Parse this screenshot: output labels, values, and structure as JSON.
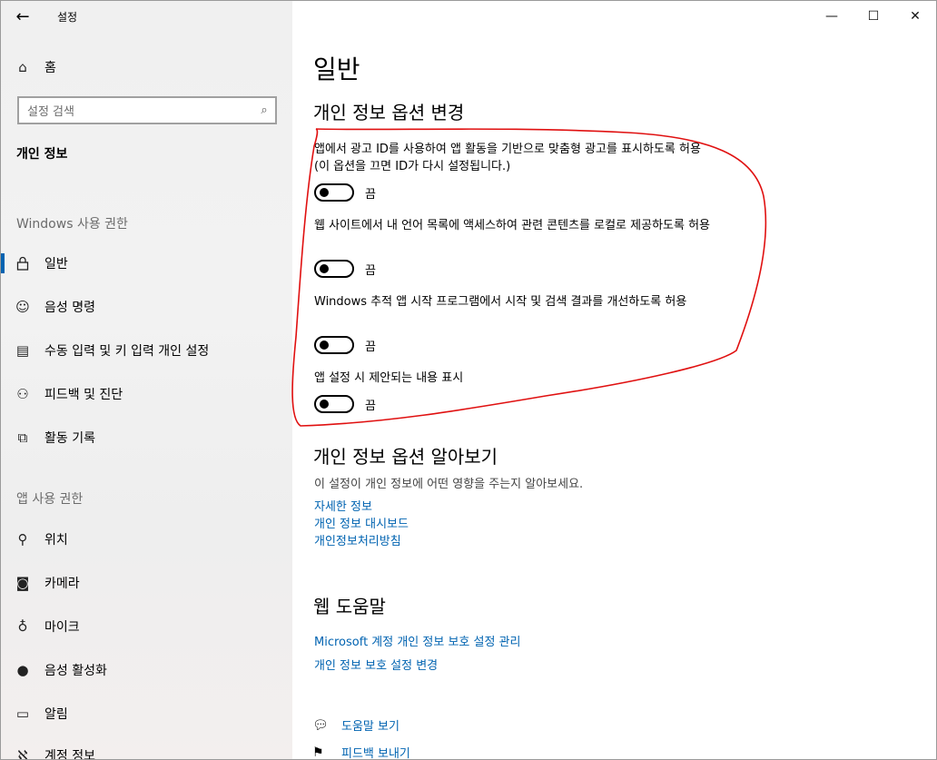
{
  "window": {
    "title": "설정",
    "back_icon": "←",
    "minimize_icon": "—",
    "maximize_icon": "☐",
    "close_icon": "✕"
  },
  "sidebar": {
    "home_label": "홈",
    "home_icon": "⌂",
    "search_placeholder": "설정 검색",
    "search_icon": "⌕",
    "category_title": "개인 정보",
    "section1_label": "Windows 사용 권한",
    "section2_label": "앱 사용 권한",
    "items": [
      {
        "label": "일반",
        "icon": "🔒︎",
        "selected": true
      },
      {
        "label": "음성 명령",
        "icon": "☺"
      },
      {
        "label": "수동 입력 및 키 입력 개인 설정",
        "icon": "▤"
      },
      {
        "label": "피드백 및 진단",
        "icon": "⚇"
      },
      {
        "label": "활동 기록",
        "icon": "⧉"
      },
      {
        "label": "위치",
        "icon": "⚲"
      },
      {
        "label": "카메라",
        "icon": "◙"
      },
      {
        "label": "마이크",
        "icon": "♁"
      },
      {
        "label": "음성 활성화",
        "icon": "●"
      },
      {
        "label": "알림",
        "icon": "▭"
      },
      {
        "label": "계정 정보",
        "icon": "ℵ"
      }
    ]
  },
  "main": {
    "title": "일반",
    "options_heading": "개인 정보 옵션 변경",
    "settings": [
      {
        "text": "앱에서 광고 ID를 사용하여 앱 활동을 기반으로 맞춤형 광고를 표시하도록 허용(이 옵션을 끄면 ID가 다시 설정됩니다.)",
        "state": "끔"
      },
      {
        "text": "웹 사이트에서 내 언어 목록에 액세스하여 관련 콘텐츠를 로컬로 제공하도록 허용",
        "state": "끔"
      },
      {
        "text": "Windows 추적 앱 시작 프로그램에서 시작 및 검색 결과를 개선하도록 허용",
        "state": "끔"
      },
      {
        "text": "앱 설정 시 제안되는 내용 표시",
        "state": "끔"
      }
    ],
    "learn_heading": "개인 정보 옵션 알아보기",
    "learn_desc": "이 설정이 개인 정보에 어떤 영향을 주는지 알아보세요.",
    "learn_links": [
      "자세한 정보",
      "개인 정보 대시보드",
      "개인정보처리방침"
    ],
    "web_help_heading": "웹 도움말",
    "web_help_links": [
      "Microsoft 계정 개인 정보 보호 설정 관리",
      "개인 정보 보호 설정 변경"
    ],
    "get_help_label": "도움말 보기",
    "get_help_icon": "💬︎",
    "feedback_label": "피드백 보내기",
    "feedback_icon": "⚑"
  },
  "colors": {
    "accent": "#0063b1",
    "annotation": "#e01010",
    "sidebar_bg": "#f2f2f2"
  }
}
